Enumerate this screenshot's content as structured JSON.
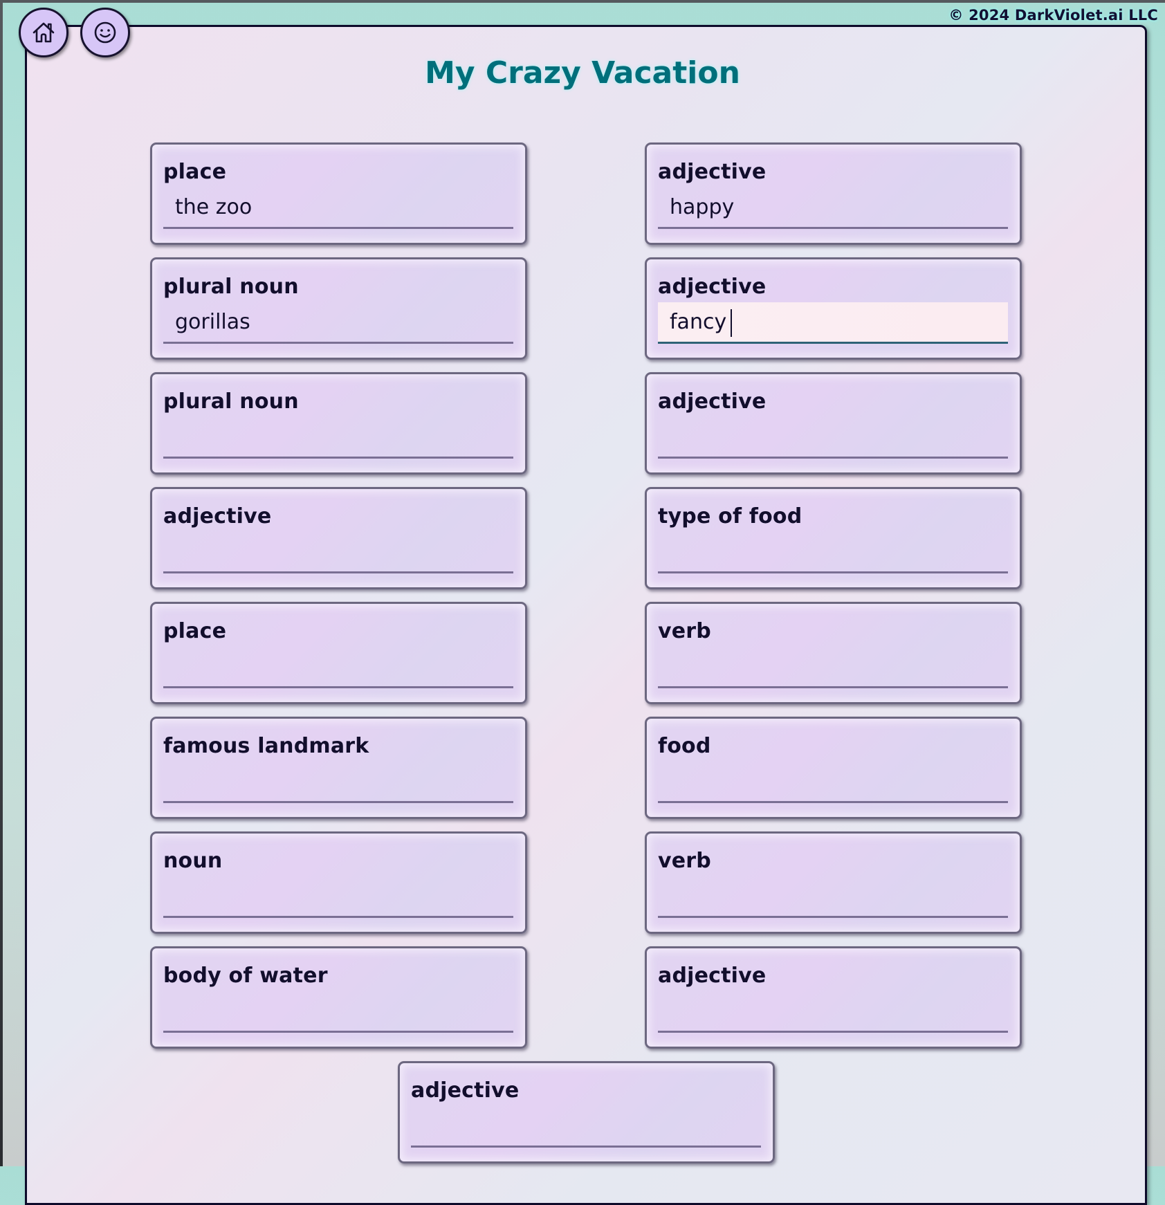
{
  "header": {
    "copyright": "© 2024 DarkViolet.ai LLC",
    "home_icon": "home-icon",
    "smiley_icon": "smiley-face-icon"
  },
  "page": {
    "title": "My Crazy Vacation"
  },
  "colors": {
    "title": "#006f7b",
    "button_fill": "#d7c6f7",
    "card_border": "#6c6780",
    "focus_underline": "#2e6277"
  },
  "fields": [
    {
      "label": "place",
      "value": "the zoo",
      "column": "left"
    },
    {
      "label": "adjective",
      "value": "happy",
      "column": "right"
    },
    {
      "label": "plural noun",
      "value": "gorillas",
      "column": "left"
    },
    {
      "label": "adjective",
      "value": "fancy",
      "column": "right",
      "focused": true
    },
    {
      "label": "plural noun",
      "value": "",
      "column": "left"
    },
    {
      "label": "adjective",
      "value": "",
      "column": "right"
    },
    {
      "label": "adjective",
      "value": "",
      "column": "left"
    },
    {
      "label": "type of food",
      "value": "",
      "column": "right"
    },
    {
      "label": "place",
      "value": "",
      "column": "left"
    },
    {
      "label": "verb",
      "value": "",
      "column": "right"
    },
    {
      "label": "famous landmark",
      "value": "",
      "column": "left"
    },
    {
      "label": "food",
      "value": "",
      "column": "right"
    },
    {
      "label": "noun",
      "value": "",
      "column": "left"
    },
    {
      "label": "verb",
      "value": "",
      "column": "right"
    },
    {
      "label": "body of water",
      "value": "",
      "column": "left"
    },
    {
      "label": "adjective",
      "value": "",
      "column": "right"
    },
    {
      "label": "adjective",
      "value": "",
      "column": "center"
    }
  ]
}
